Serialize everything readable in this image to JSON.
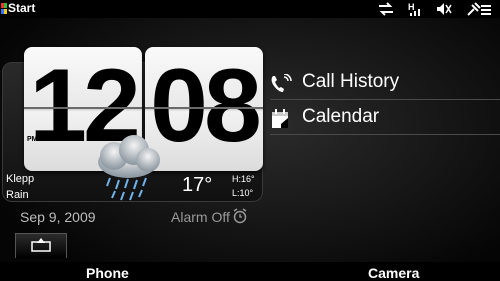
{
  "topbar": {
    "start_label": "Start",
    "icons": [
      "sync-arrows-icon",
      "signal-h-icon",
      "volume-muted-icon",
      "battery-charging-icon"
    ]
  },
  "clock": {
    "hour": "12",
    "minute": "08",
    "ampm": "PM",
    "location": "Klepp",
    "condition": "Rain",
    "temperature": "17°",
    "high": "H:16°",
    "low": "L:10°",
    "date": "Sep 9, 2009",
    "alarm": "Alarm Off"
  },
  "shortcuts": [
    {
      "label": "Call History",
      "icon": "call-history-icon"
    },
    {
      "label": "Calendar",
      "icon": "calendar-icon"
    }
  ],
  "softkeys": {
    "left": "Phone",
    "right": "Camera"
  }
}
